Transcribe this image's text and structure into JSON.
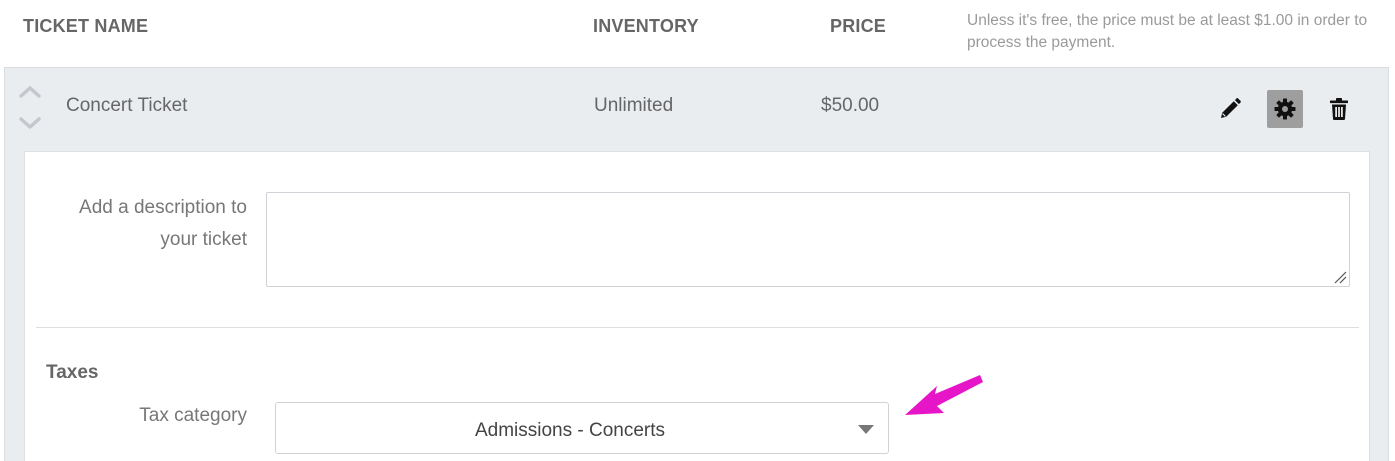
{
  "columns": {
    "ticket_name": "TICKET NAME",
    "inventory": "INVENTORY",
    "price": "PRICE"
  },
  "price_hint": "Unless it's free, the price must be at least $1.00 in order to process the payment.",
  "ticket": {
    "name": "Concert Ticket",
    "inventory": "Unlimited",
    "price": "$50.00"
  },
  "icons": {
    "move_up": "chevron-up-icon",
    "move_down": "chevron-down-icon",
    "edit": "pencil-icon",
    "settings": "gear-icon",
    "delete": "trash-icon",
    "select_caret": "caret-down-icon",
    "annotation": "magenta-arrow-icon"
  },
  "settings_panel": {
    "description_label": "Add a description to your ticket",
    "description_value": "",
    "taxes_title": "Taxes",
    "tax_category_label": "Tax category",
    "tax_category_value": "Admissions - Concerts"
  },
  "colors": {
    "row_background": "#eaedf0",
    "active_button": "#9e9e9e",
    "annotation_arrow": "#e616c8"
  }
}
